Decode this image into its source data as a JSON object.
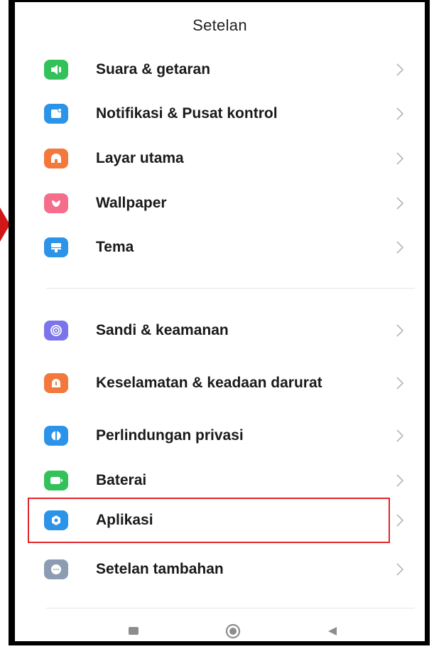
{
  "header": {
    "title": "Setelan"
  },
  "group1": [
    {
      "label": "Suara & getaran",
      "icon": "speaker-icon",
      "color": "#33c15a"
    },
    {
      "label": "Notifikasi & Pusat kontrol",
      "icon": "notification-icon",
      "color": "#2b93e8"
    },
    {
      "label": "Layar utama",
      "icon": "home-icon",
      "color": "#f2783c"
    },
    {
      "label": "Wallpaper",
      "icon": "flower-icon",
      "color": "#f46e8c"
    },
    {
      "label": "Tema",
      "icon": "theme-icon",
      "color": "#2b93e8"
    }
  ],
  "group2": [
    {
      "label": "Sandi & keamanan",
      "icon": "fingerprint-icon",
      "color": "#7b74ea"
    },
    {
      "label": "Keselamatan & keadaan darurat",
      "icon": "emergency-icon",
      "color": "#f2783c"
    },
    {
      "label": "Perlindungan privasi",
      "icon": "privacy-icon",
      "color": "#2b93e8"
    },
    {
      "label": "Baterai",
      "icon": "battery-icon",
      "color": "#33c15a"
    },
    {
      "label": "Aplikasi",
      "icon": "gear-icon",
      "color": "#2b93e8",
      "highlighted": true
    },
    {
      "label": "Setelan tambahan",
      "icon": "more-icon",
      "color": "#8c9db3"
    }
  ],
  "colors": {
    "highlight": "#e1262a",
    "chevron": "#b5b5b5",
    "text": "#1a1a1a"
  },
  "navbar": {
    "icons": [
      "recents-square-icon",
      "home-circle-icon",
      "back-triangle-icon"
    ]
  }
}
